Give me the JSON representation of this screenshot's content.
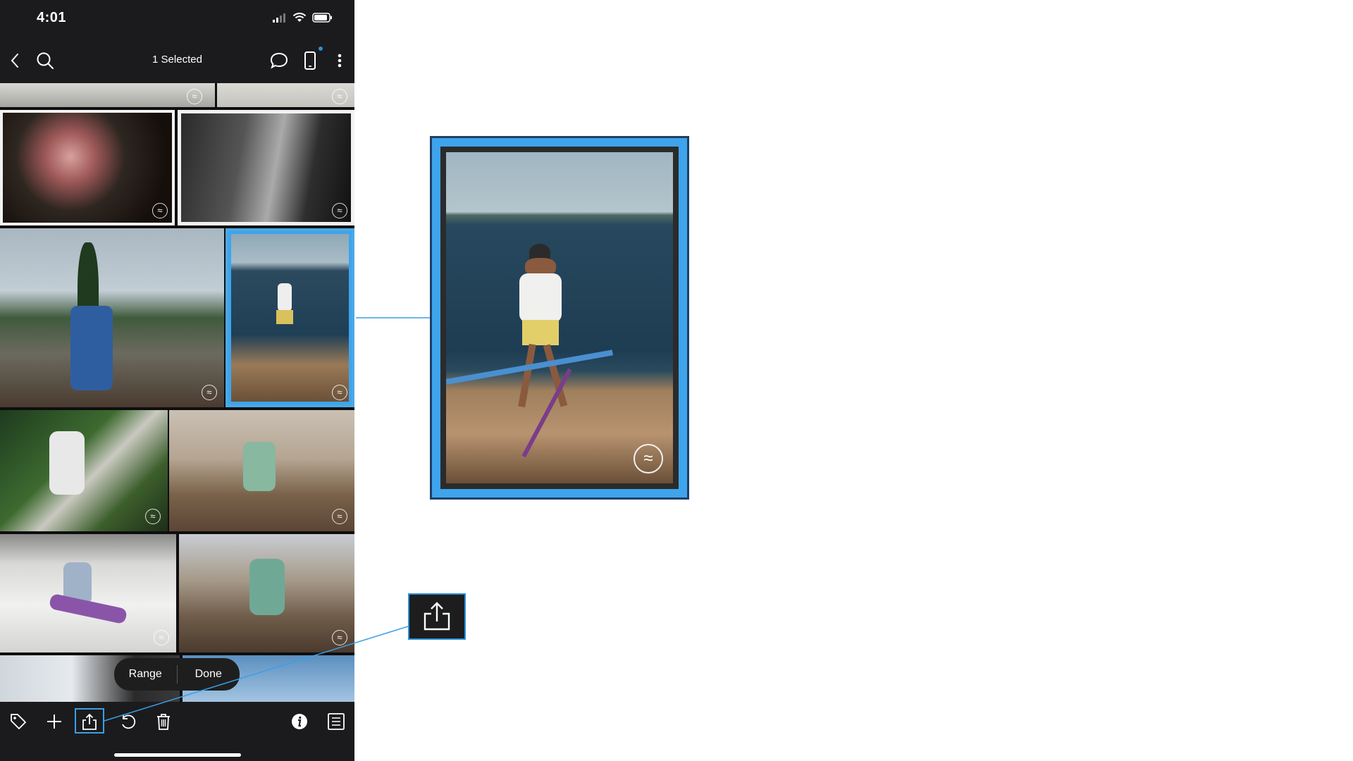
{
  "status_bar": {
    "time": "4:01"
  },
  "nav": {
    "title": "1 Selected"
  },
  "popup": {
    "range_label": "Range",
    "done_label": "Done"
  },
  "colors": {
    "accent": "#4aa8e6",
    "dark": "#1b1b1d"
  },
  "icons": {
    "nav": [
      "back-chevron-icon",
      "search-icon",
      "comment-icon",
      "phone-icon",
      "more-vertical-icon"
    ],
    "toolbar": [
      "tag-icon",
      "plus-icon",
      "share-icon",
      "undo-icon",
      "trash-icon",
      "info-icon",
      "list-icon"
    ]
  }
}
